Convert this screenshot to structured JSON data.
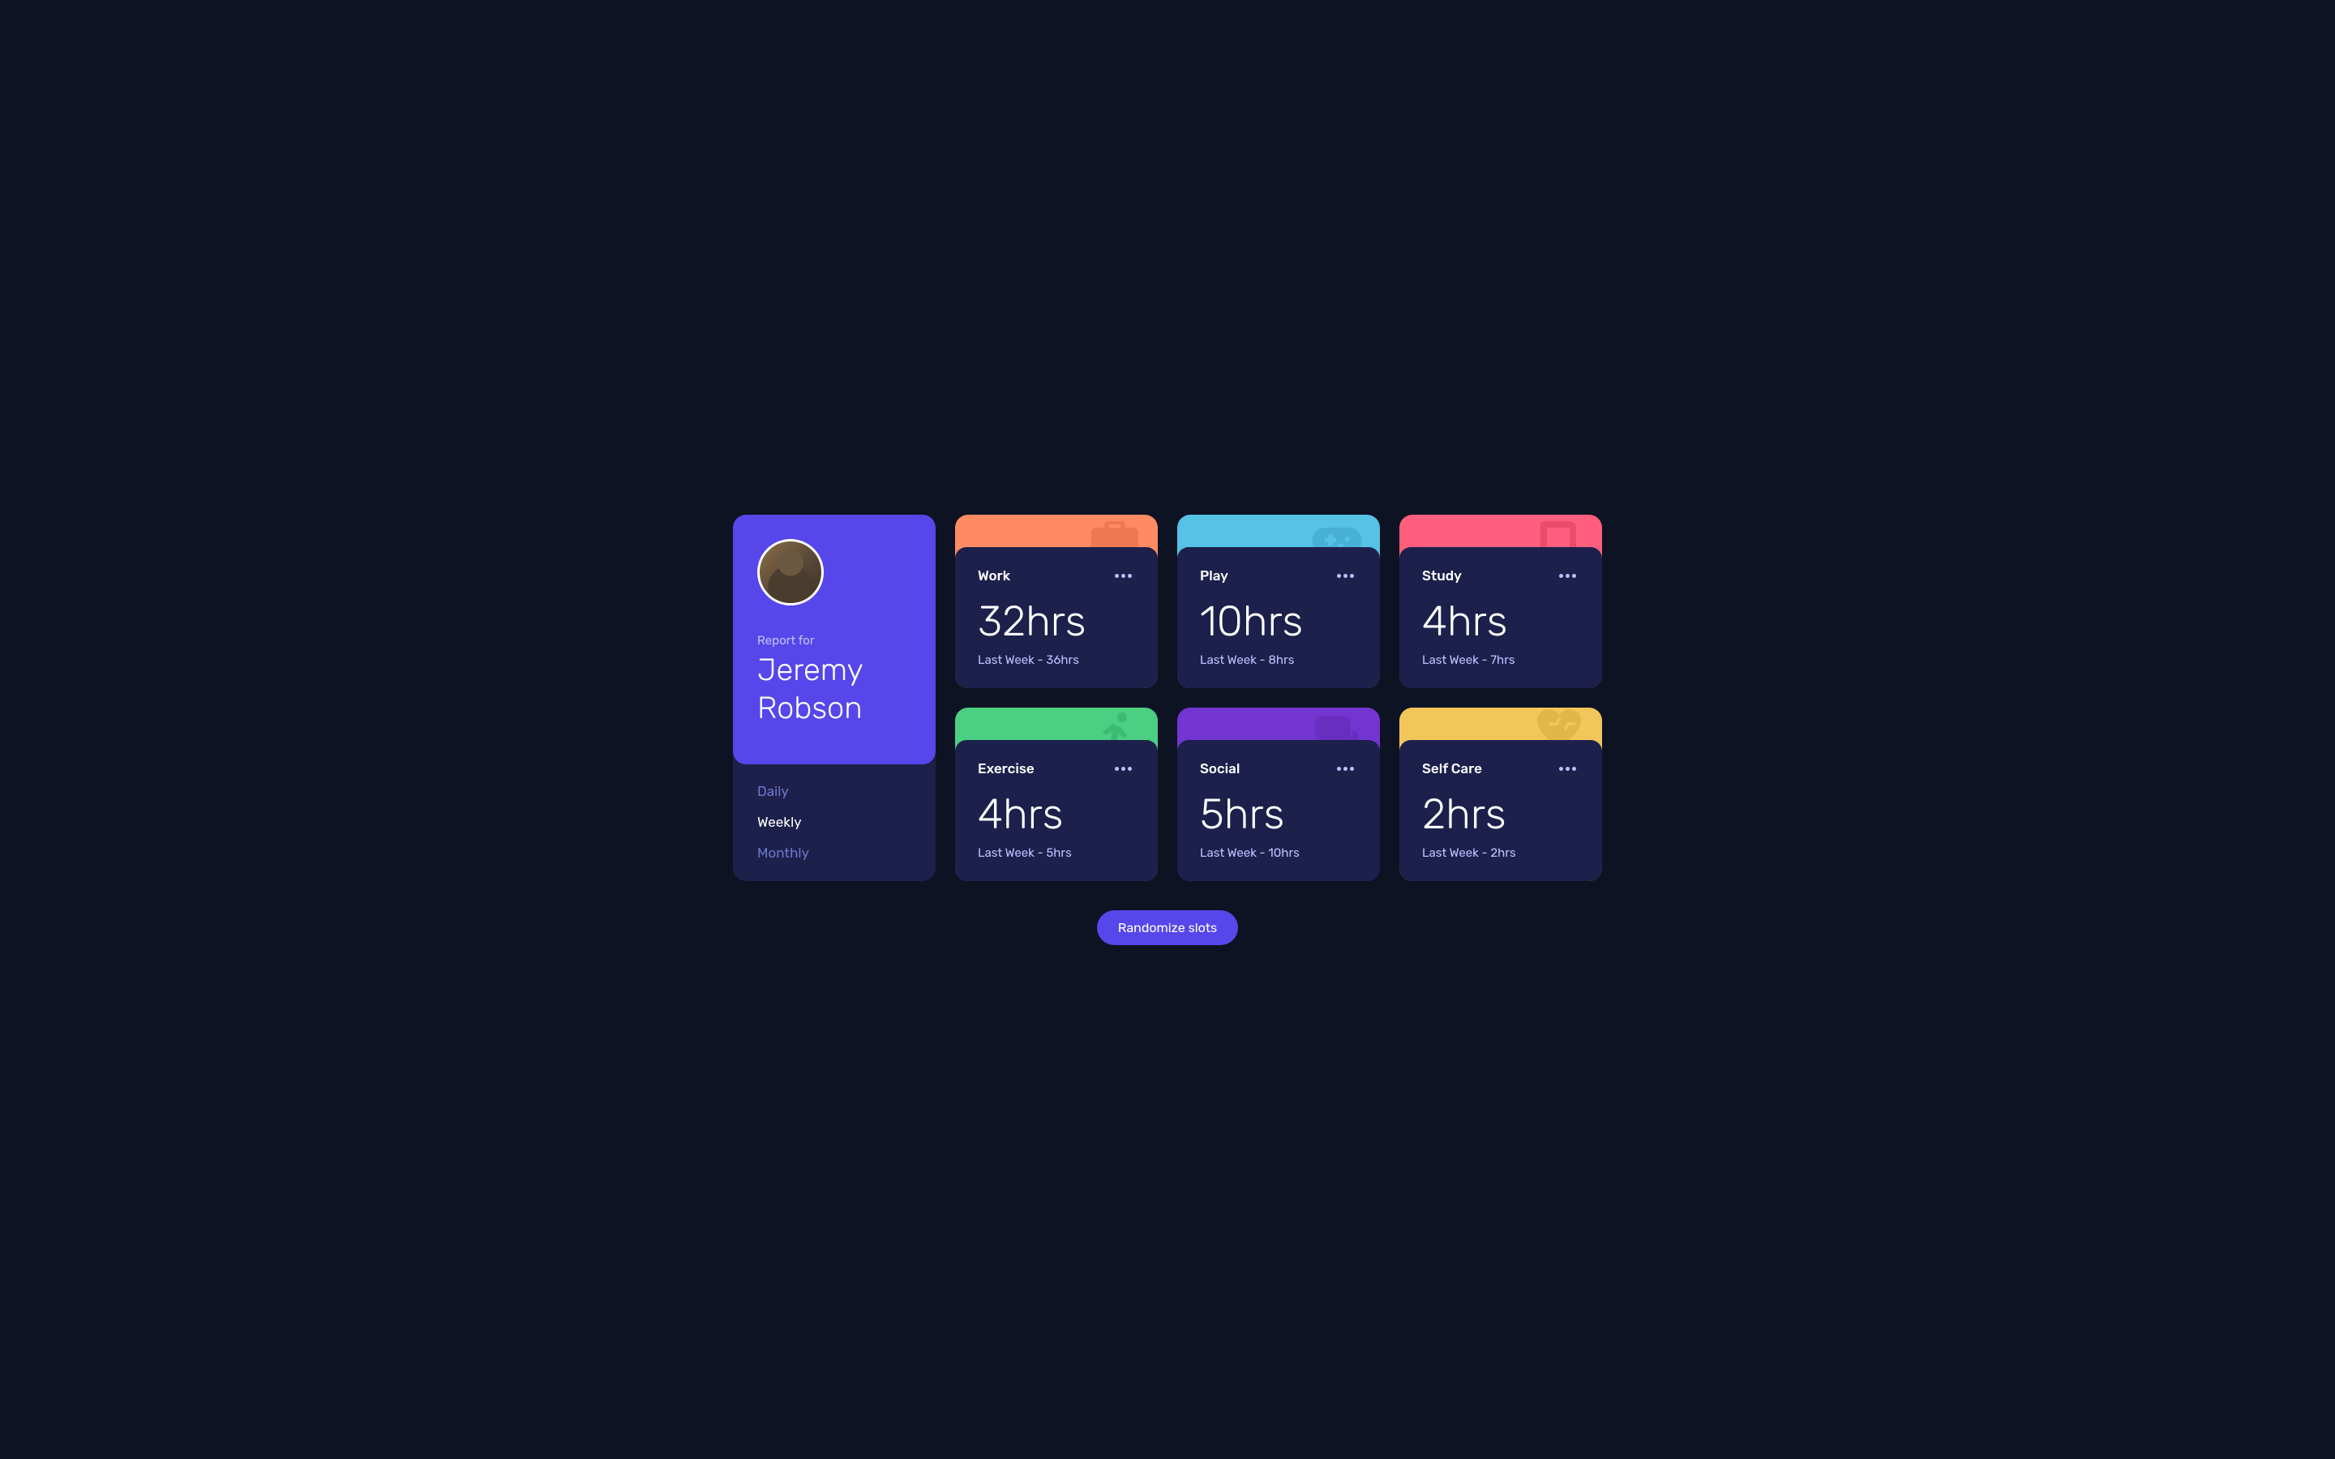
{
  "profile": {
    "report_label": "Report for",
    "name": "Jeremy Robson"
  },
  "timeframes": {
    "items": [
      {
        "label": "Daily",
        "active": false
      },
      {
        "label": "Weekly",
        "active": true
      },
      {
        "label": "Monthly",
        "active": false
      }
    ]
  },
  "activities": [
    {
      "title": "Work",
      "hours": "32hrs",
      "previous": "Last Week - 36hrs",
      "color": "#ff8b64",
      "icon": "briefcase-icon"
    },
    {
      "title": "Play",
      "hours": "10hrs",
      "previous": "Last Week - 8hrs",
      "color": "#55c2e6",
      "icon": "gamepad-icon"
    },
    {
      "title": "Study",
      "hours": "4hrs",
      "previous": "Last Week - 7hrs",
      "color": "#ff5e7d",
      "icon": "book-icon"
    },
    {
      "title": "Exercise",
      "hours": "4hrs",
      "previous": "Last Week - 5hrs",
      "color": "#4bcf82",
      "icon": "running-icon"
    },
    {
      "title": "Social",
      "hours": "5hrs",
      "previous": "Last Week - 10hrs",
      "color": "#7335d2",
      "icon": "chat-icon"
    },
    {
      "title": "Self Care",
      "hours": "2hrs",
      "previous": "Last Week - 2hrs",
      "color": "#f1c75b",
      "icon": "heart-icon"
    }
  ],
  "button": {
    "randomize_label": "Randomize slots"
  }
}
